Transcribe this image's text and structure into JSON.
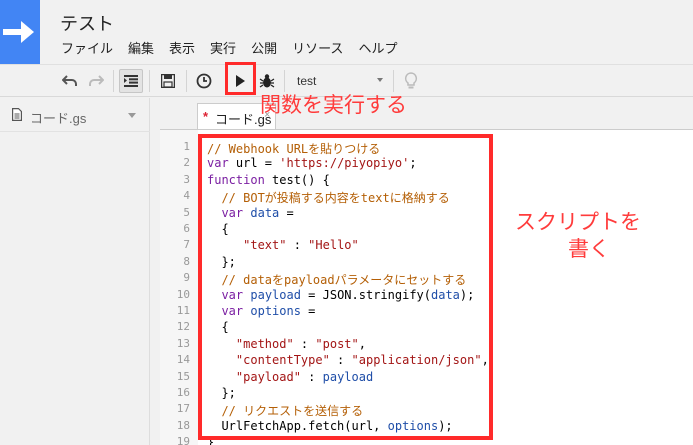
{
  "app": {
    "title": "テスト",
    "menu": [
      "ファイル",
      "編集",
      "表示",
      "実行",
      "公開",
      "リソース",
      "ヘルプ"
    ]
  },
  "toolbar": {
    "buttons": [
      "undo-icon",
      "redo-icon",
      "indent-icon",
      "save-icon",
      "clock-icon",
      "run-icon",
      "bug-icon",
      "lightbulb-icon"
    ],
    "function_select": "test"
  },
  "sidebar": {
    "file_name": "コード.gs"
  },
  "editor": {
    "tab": {
      "modified_marker": "*",
      "name": "コード.gs",
      "close": "×"
    },
    "lines": [
      {
        "n": "1",
        "tokens": [
          {
            "t": "// Webhook URLを貼りつける",
            "c": "cm"
          }
        ]
      },
      {
        "n": "2",
        "tokens": [
          {
            "t": "var",
            "c": "kw"
          },
          {
            "t": " url = ",
            "c": "pl"
          },
          {
            "t": "'https://piyopiyo'",
            "c": "str"
          },
          {
            "t": ";",
            "c": "pl"
          }
        ]
      },
      {
        "n": "3",
        "tokens": [
          {
            "t": "function",
            "c": "kw"
          },
          {
            "t": " test() {",
            "c": "pl"
          }
        ]
      },
      {
        "n": "4",
        "tokens": [
          {
            "t": "  // BOTが投稿する内容をtextに格納する",
            "c": "cm"
          }
        ]
      },
      {
        "n": "5",
        "tokens": [
          {
            "t": "  ",
            "c": "pl"
          },
          {
            "t": "var",
            "c": "kw"
          },
          {
            "t": " ",
            "c": "pl"
          },
          {
            "t": "data",
            "c": "var"
          },
          {
            "t": " =",
            "c": "pl"
          }
        ]
      },
      {
        "n": "6",
        "tokens": [
          {
            "t": "  {",
            "c": "pl"
          }
        ]
      },
      {
        "n": "7",
        "tokens": [
          {
            "t": "     ",
            "c": "pl"
          },
          {
            "t": "\"text\"",
            "c": "str"
          },
          {
            "t": " : ",
            "c": "pl"
          },
          {
            "t": "\"Hello\"",
            "c": "str"
          }
        ]
      },
      {
        "n": "8",
        "tokens": [
          {
            "t": "  };",
            "c": "pl"
          }
        ]
      },
      {
        "n": "9",
        "tokens": [
          {
            "t": "  // dataをpayloadパラメータにセットする",
            "c": "cm"
          }
        ]
      },
      {
        "n": "10",
        "tokens": [
          {
            "t": "  ",
            "c": "pl"
          },
          {
            "t": "var",
            "c": "kw"
          },
          {
            "t": " ",
            "c": "pl"
          },
          {
            "t": "payload",
            "c": "var"
          },
          {
            "t": " = JSON.stringify(",
            "c": "pl"
          },
          {
            "t": "data",
            "c": "var"
          },
          {
            "t": ");",
            "c": "pl"
          }
        ]
      },
      {
        "n": "11",
        "tokens": [
          {
            "t": "  ",
            "c": "pl"
          },
          {
            "t": "var",
            "c": "kw"
          },
          {
            "t": " ",
            "c": "pl"
          },
          {
            "t": "options",
            "c": "var"
          },
          {
            "t": " =",
            "c": "pl"
          }
        ]
      },
      {
        "n": "12",
        "tokens": [
          {
            "t": "  {",
            "c": "pl"
          }
        ]
      },
      {
        "n": "13",
        "tokens": [
          {
            "t": "    ",
            "c": "pl"
          },
          {
            "t": "\"method\"",
            "c": "str"
          },
          {
            "t": " : ",
            "c": "pl"
          },
          {
            "t": "\"post\"",
            "c": "str"
          },
          {
            "t": ",",
            "c": "pl"
          }
        ]
      },
      {
        "n": "14",
        "tokens": [
          {
            "t": "    ",
            "c": "pl"
          },
          {
            "t": "\"contentType\"",
            "c": "str"
          },
          {
            "t": " : ",
            "c": "pl"
          },
          {
            "t": "\"application/json\"",
            "c": "str"
          },
          {
            "t": ",",
            "c": "pl"
          }
        ]
      },
      {
        "n": "15",
        "tokens": [
          {
            "t": "    ",
            "c": "pl"
          },
          {
            "t": "\"payload\"",
            "c": "str"
          },
          {
            "t": " : ",
            "c": "pl"
          },
          {
            "t": "payload",
            "c": "var"
          }
        ]
      },
      {
        "n": "16",
        "tokens": [
          {
            "t": "  };",
            "c": "pl"
          }
        ]
      },
      {
        "n": "17",
        "tokens": [
          {
            "t": "  // リクエストを送信する",
            "c": "cm"
          }
        ]
      },
      {
        "n": "18",
        "tokens": [
          {
            "t": "  UrlFetchApp.fetch(url, ",
            "c": "pl"
          },
          {
            "t": "options",
            "c": "var"
          },
          {
            "t": ");",
            "c": "pl"
          }
        ]
      },
      {
        "n": "19",
        "tokens": [
          {
            "t": "}",
            "c": "pl"
          }
        ]
      }
    ]
  },
  "annotations": {
    "run_label": "関数を実行する",
    "code_label_line1": "スクリプトを",
    "code_label_line2": "書く",
    "color": "#ff2a2a"
  }
}
